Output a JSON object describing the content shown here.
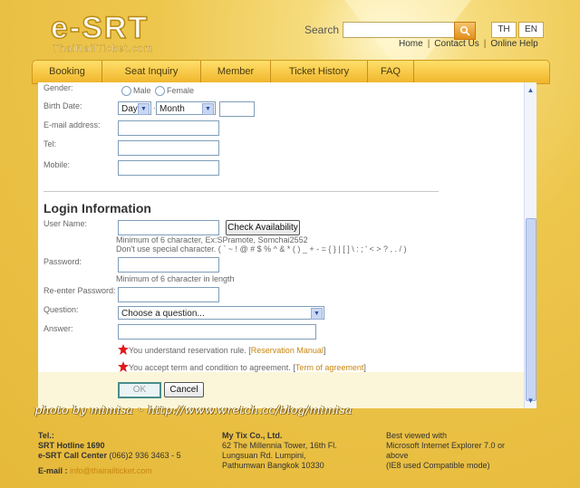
{
  "logo": {
    "main": "e-SRT",
    "sub": "ThaiRailTicket.com"
  },
  "header": {
    "search_label": "Search",
    "search_value": "",
    "lang_th": "TH",
    "lang_en": "EN",
    "links": [
      "Home",
      "Contact Us",
      "Online Help"
    ]
  },
  "nav": {
    "items": [
      "Booking",
      "Seat Inquiry",
      "Member",
      "Ticket History",
      "FAQ"
    ]
  },
  "form": {
    "gender_label": "Gender:",
    "gender_male": "Male",
    "gender_female": "Female",
    "birth_label": "Birth Date:",
    "day_select": "Day",
    "dot": ".",
    "month_select": "Month",
    "email_label": "E-mail address:",
    "tel_label": "Tel:",
    "mobile_label": "Mobile:",
    "login_title": "Login Information",
    "username_label": "User Name:",
    "check_button": "Check Availability",
    "username_hint1": "Minimum of 6 character, Ex:SPramote, Somchai2552",
    "username_hint2": "Don't use special character. ( ` ~ ! @ # $ % ^ & * ( ) _ + - = { } | [ ] \\ : ; ' < > ? , . / )",
    "password_label": "Password:",
    "password_hint": "Minimum of 6 character in length",
    "reenter_label": "Re-enter Password:",
    "question_label": "Question:",
    "question_select": "Choose a question...",
    "answer_label": "Answer:",
    "agree1_text": "You understand reservation rule.",
    "agree1_link": "Reservation Manual",
    "agree2_text": "You accept term and condition to agreement.",
    "agree2_link": "Term of agreement",
    "bracket_open": "[",
    "bracket_close": "]",
    "ok_button": "OK",
    "cancel_button": "Cancel"
  },
  "watermark": "photo by mimisa ◦ http://www.wretch.cc/blog/mimisa",
  "footer": {
    "tel_label": "Tel.:",
    "hotline": "SRT Hotline 1690",
    "callcenter_label": "e-SRT Call Center",
    "callcenter_number": "(066)2 936 3463 - 5",
    "email_label": "E-mail :",
    "email": "info@thairailticket.com",
    "company": "My Tix Co., Ltd.",
    "address1": "62 The Millennia Tower, 16th Fl.",
    "address2": "Lungsuan Rd. Lumpini,",
    "address3": "Pathumwan Bangkok 10330",
    "best1": "Best viewed with",
    "best2": "Microsoft Internet Explorer 7.0 or",
    "best3": "above",
    "best4": "(IE8 used Compatible mode)"
  },
  "colors": {
    "accent": "#c8860e",
    "nav_bg": "#f0b52a",
    "page_bg": "#edc64c"
  },
  "icons": {
    "search": "search-icon",
    "star": "red-star-icon"
  }
}
